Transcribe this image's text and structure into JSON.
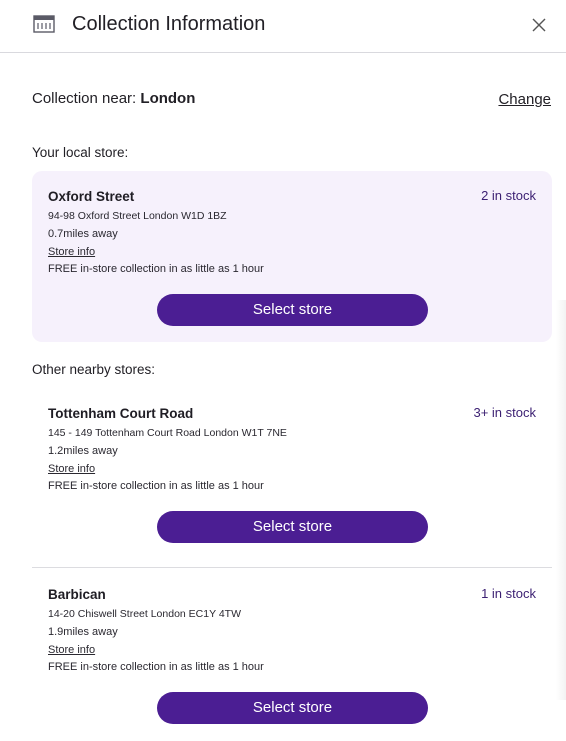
{
  "header": {
    "title": "Collection Information",
    "icon": "store-icon",
    "close_icon": "close-icon"
  },
  "location": {
    "prefix": "Collection near:",
    "city": "London",
    "change_label": "Change"
  },
  "local_section": {
    "label": "Your local store:"
  },
  "other_section": {
    "label": "Other nearby stores:"
  },
  "stores": [
    {
      "name": "Oxford Street",
      "stock": "2 in stock",
      "address": "94-98 Oxford Street London W1D 1BZ",
      "distance": "0.7miles away",
      "info_label": "Store info",
      "collection": "FREE in-store collection in as little as 1 hour",
      "button_label": "Select store"
    },
    {
      "name": "Tottenham Court Road",
      "stock": "3+ in stock",
      "address": "145 - 149 Tottenham Court Road London W1T 7NE",
      "distance": "1.2miles away",
      "info_label": "Store info",
      "collection": "FREE in-store collection in as little as 1 hour",
      "button_label": "Select store"
    },
    {
      "name": "Barbican",
      "stock": "1 in stock",
      "address": "14-20 Chiswell Street London EC1Y 4TW",
      "distance": "1.9miles away",
      "info_label": "Store info",
      "collection": "FREE in-store collection in as little as 1 hour",
      "button_label": "Select store"
    }
  ],
  "colors": {
    "accent": "#4b1e93",
    "stock_text": "#3b1f72",
    "local_card_bg": "#f6f1fc"
  }
}
